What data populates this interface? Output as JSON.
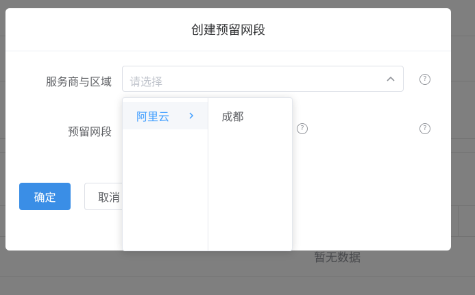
{
  "background": {
    "empty_text": "暂无数据"
  },
  "dialog": {
    "title": "创建预留网段",
    "form": {
      "provider_label": "服务商与区域",
      "provider_placeholder": "请选择",
      "segment_label": "预留网段"
    },
    "buttons": {
      "confirm_label": "确定",
      "cancel_label": "取消"
    }
  },
  "cascader": {
    "level1": [
      {
        "label": "阿里云",
        "active": true
      }
    ],
    "level2": [
      {
        "label": "成都"
      }
    ]
  },
  "colors": {
    "primary": "#409eff",
    "confirm_button": "#3a8ee6",
    "overlay": "rgba(0,0,0,0.5)"
  },
  "icons": {
    "help": "question-circle-icon",
    "select_arrow": "chevron-up-icon",
    "node_arrow": "chevron-right-icon"
  }
}
